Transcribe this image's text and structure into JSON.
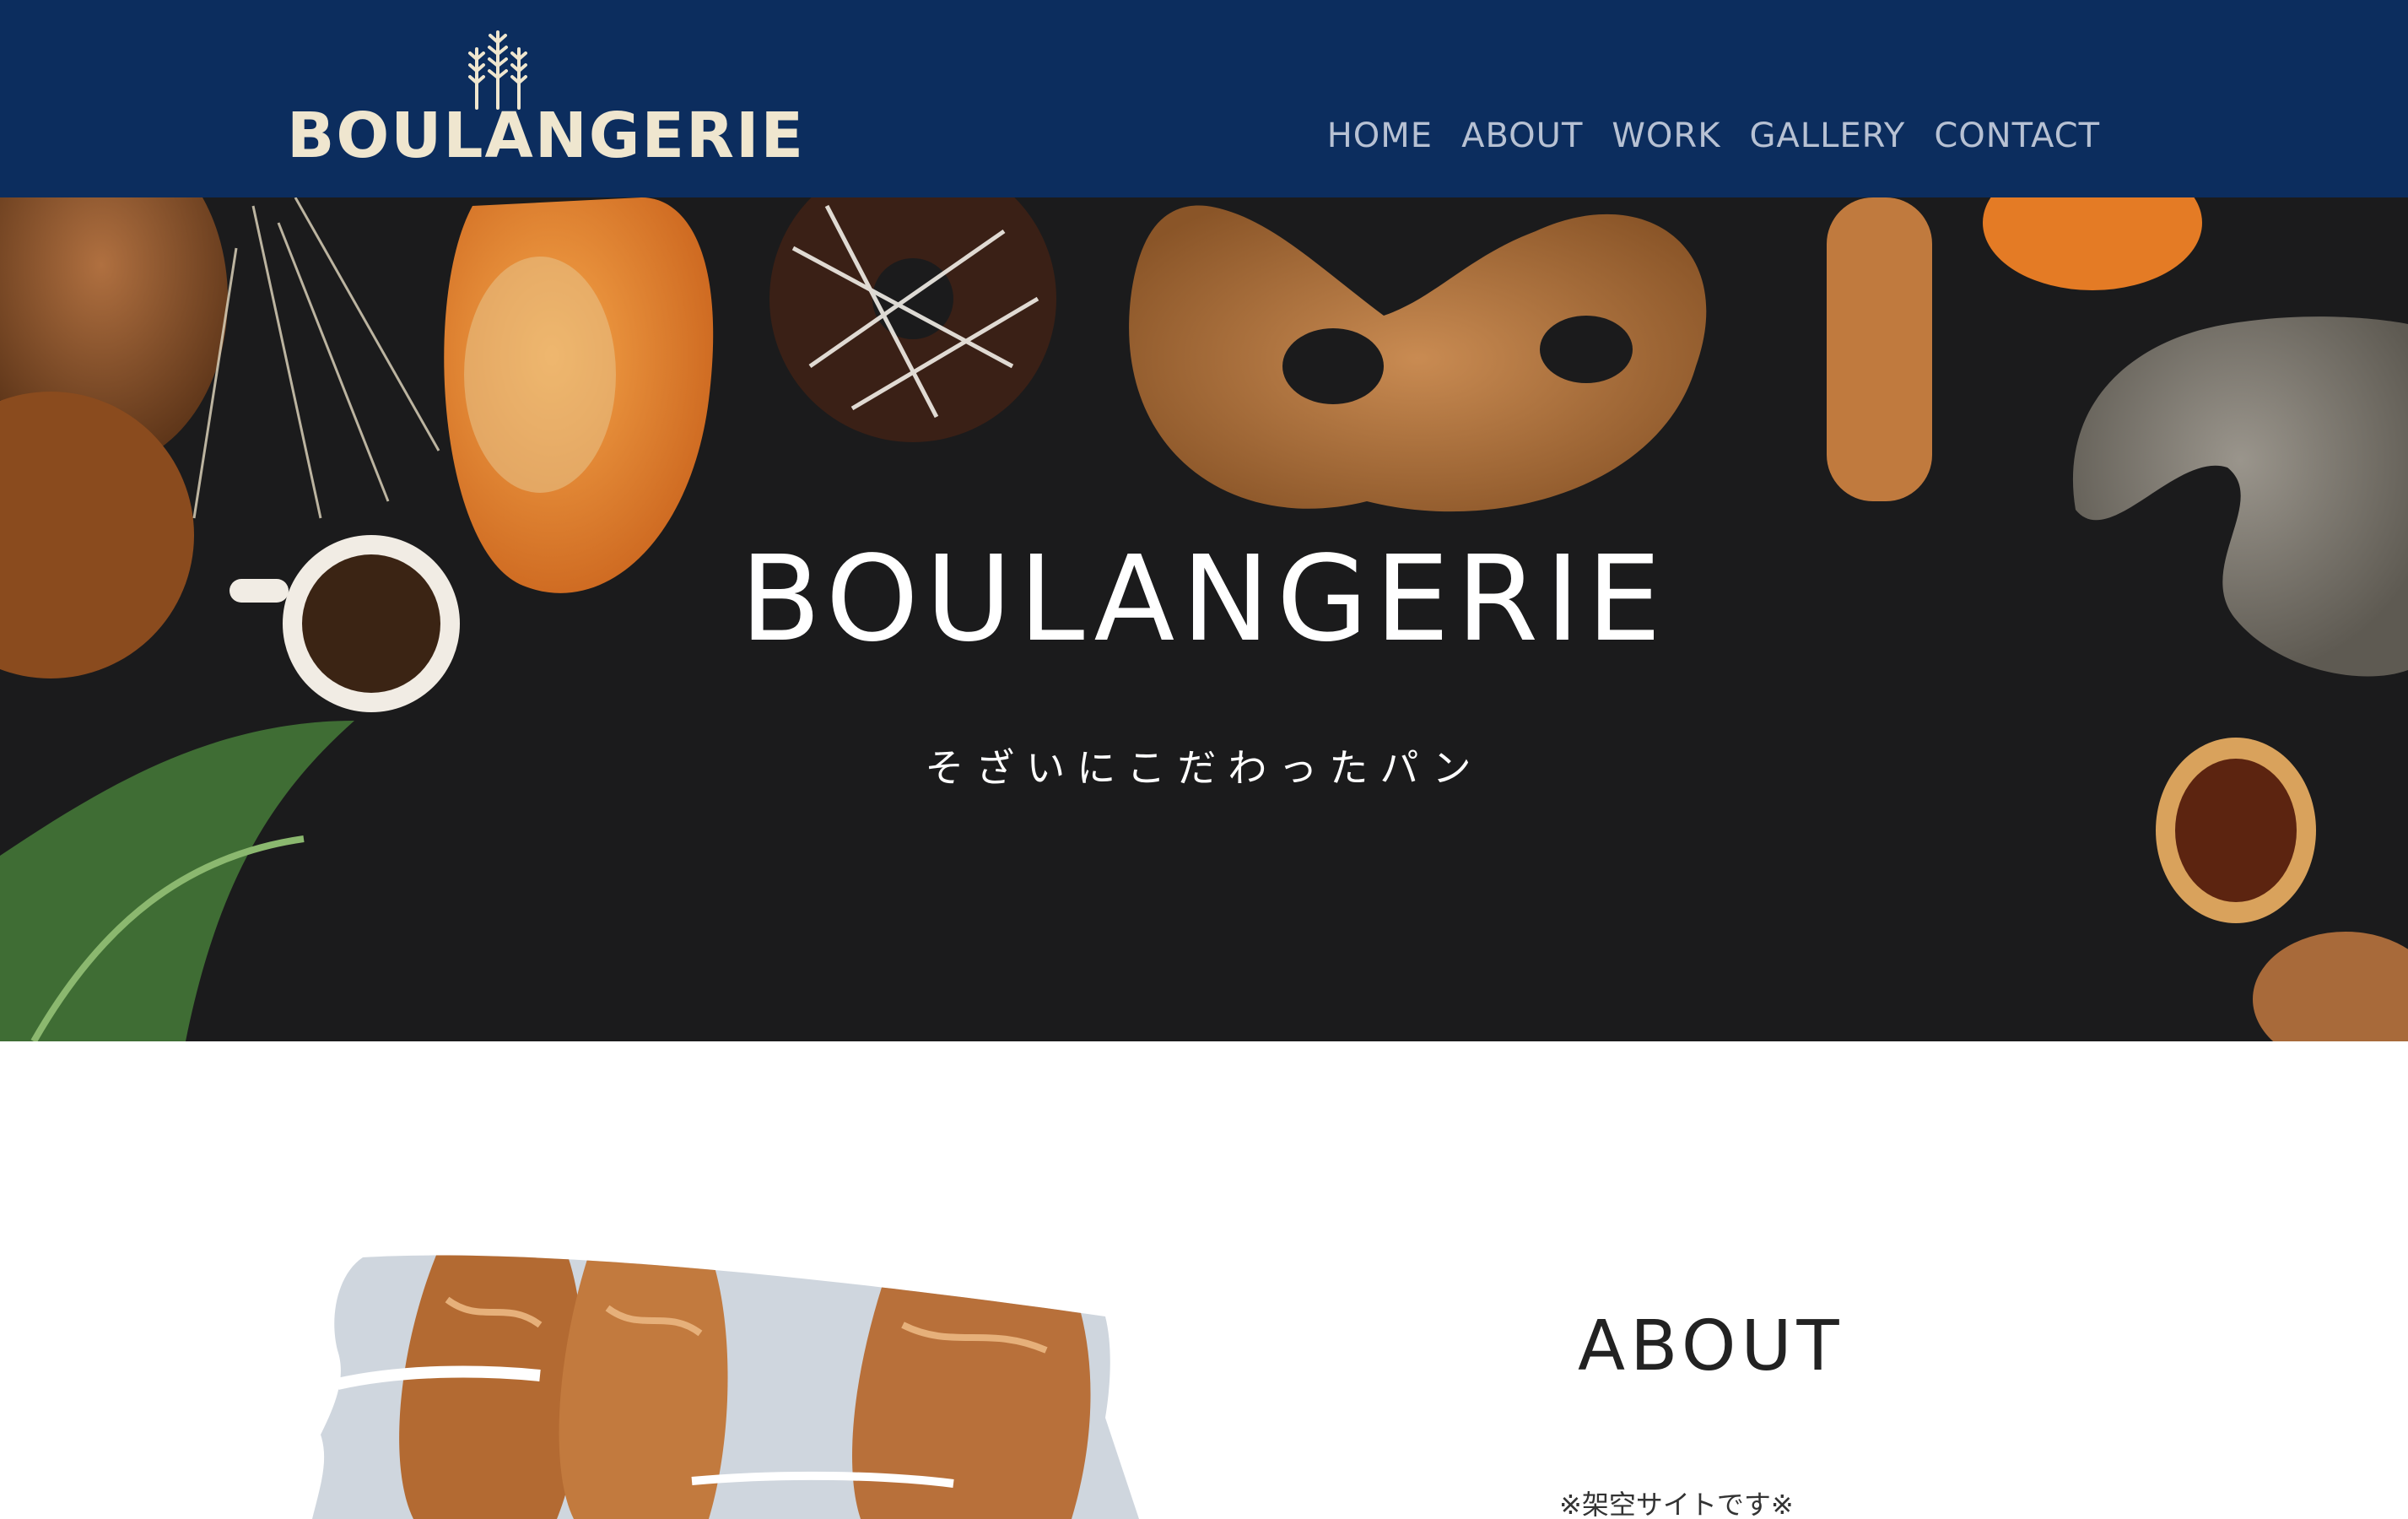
{
  "header": {
    "logo_text": "BOULANGERIE",
    "nav": [
      {
        "label": "HOME"
      },
      {
        "label": "ABOUT"
      },
      {
        "label": "WORK"
      },
      {
        "label": "GALLERY"
      },
      {
        "label": "CONTACT"
      }
    ]
  },
  "hero": {
    "title": "BOULANGERIE",
    "subtitle": "そざいにこだわったパン"
  },
  "about": {
    "title": "ABOUT",
    "note": "※架空サイトです※"
  },
  "colors": {
    "header_bg": "#0c2d5e",
    "logo": "#efe6cf",
    "nav": "#b7c1d3",
    "hero_bg": "#1b1b1c"
  }
}
